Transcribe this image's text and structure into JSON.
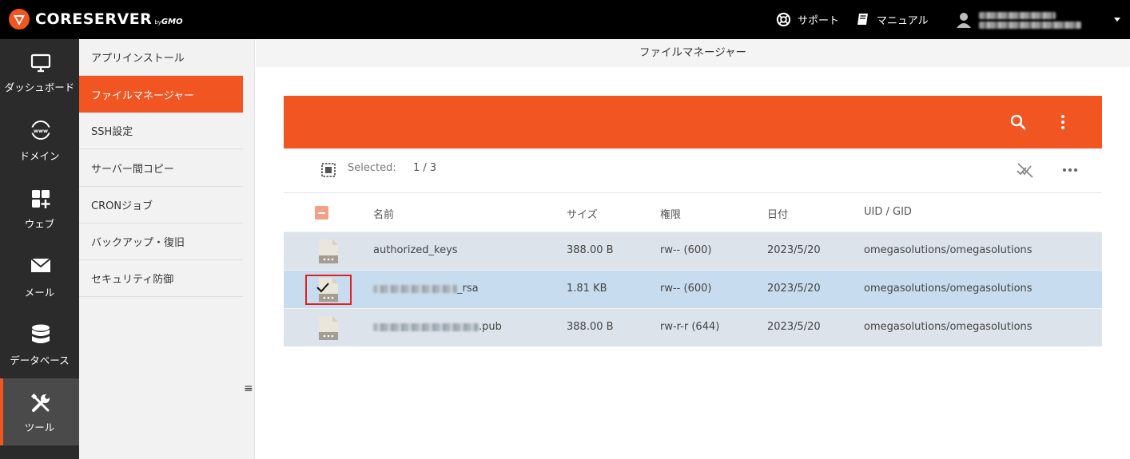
{
  "header": {
    "brand": "CORESERVER",
    "brand_by": "by",
    "brand_gmo": "GMO",
    "support_label": "サポート",
    "manual_label": "マニュアル"
  },
  "nav": {
    "items": [
      {
        "label": "ダッシュボード",
        "icon": "monitor-icon"
      },
      {
        "label": "ドメイン",
        "icon": "www-globe-icon"
      },
      {
        "label": "ウェブ",
        "icon": "grid-plus-icon"
      },
      {
        "label": "メール",
        "icon": "envelope-icon"
      },
      {
        "label": "データベース",
        "icon": "database-icon"
      },
      {
        "label": "ツール",
        "icon": "tools-icon",
        "active": true
      }
    ]
  },
  "submenu": {
    "items": [
      {
        "label": "アプリインストール"
      },
      {
        "label": "ファイルマネージャー",
        "active": true
      },
      {
        "label": "SSH設定"
      },
      {
        "label": "サーバー間コピー"
      },
      {
        "label": "CRONジョブ"
      },
      {
        "label": "バックアップ・復旧"
      },
      {
        "label": "セキュリティ防御"
      }
    ],
    "collapse_glyph": "≡"
  },
  "page": {
    "title": "ファイルマネージャー"
  },
  "toolbar": {
    "selected_label": "Selected:",
    "selected_count": "1 / 3"
  },
  "table": {
    "columns": {
      "name": "名前",
      "size": "サイズ",
      "perm": "権限",
      "date": "日付",
      "owner": "UID / GID"
    },
    "rows": [
      {
        "name": "authorized_keys",
        "size": "388.00 B",
        "perm": "rw-- (600)",
        "date": "2023/5/20",
        "owner": "omegasolutions/omegasolutions",
        "selected": false
      },
      {
        "name_suffix": "_rsa",
        "size": "1.81 KB",
        "perm": "rw-- (600)",
        "date": "2023/5/20",
        "owner": "omegasolutions/omegasolutions",
        "selected": true
      },
      {
        "name_suffix": ".pub",
        "size": "388.00 B",
        "perm": "rw-r-r (644)",
        "date": "2023/5/20",
        "owner": "omegasolutions/omegasolutions",
        "selected": false
      }
    ]
  },
  "colors": {
    "accent": "#f15522",
    "nav_bg": "#2b2b2b",
    "topbar_bg": "#000000",
    "row_bg": "#dde3eb",
    "row_selected_bg": "#c7dcee",
    "highlight": "#e02020"
  }
}
